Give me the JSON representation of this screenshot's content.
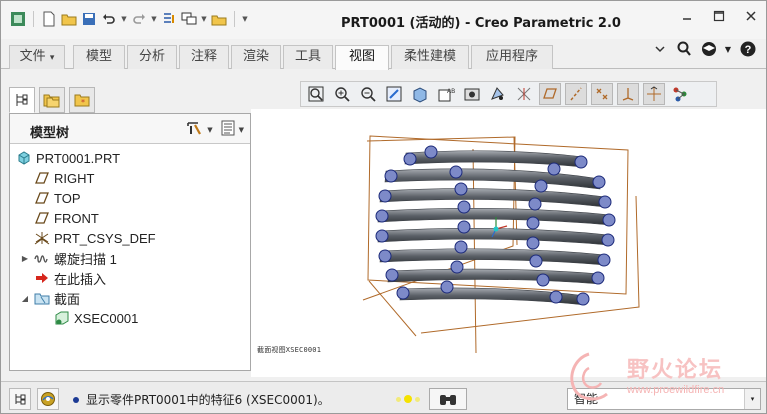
{
  "window": {
    "title": "PRT0001 (活动的) - Creo Parametric 2.0"
  },
  "ribbon": {
    "tabs": [
      {
        "label": "文件",
        "id": "file"
      },
      {
        "label": "模型",
        "id": "model"
      },
      {
        "label": "分析",
        "id": "analysis"
      },
      {
        "label": "注释",
        "id": "annotate"
      },
      {
        "label": "渲染",
        "id": "render"
      },
      {
        "label": "工具",
        "id": "tools"
      },
      {
        "label": "视图",
        "id": "view"
      },
      {
        "label": "柔性建模",
        "id": "flexible"
      },
      {
        "label": "应用程序",
        "id": "apps"
      }
    ],
    "active_tab": "视图",
    "file_dropdown_glyph": "▾"
  },
  "model_tree": {
    "header": "模型树",
    "nodes": [
      {
        "label": "PRT0001.PRT",
        "icon": "part-icon"
      },
      {
        "label": "RIGHT",
        "icon": "datum-plane-icon"
      },
      {
        "label": "TOP",
        "icon": "datum-plane-icon"
      },
      {
        "label": "FRONT",
        "icon": "datum-plane-icon"
      },
      {
        "label": "PRT_CSYS_DEF",
        "icon": "csys-icon"
      },
      {
        "label": "螺旋扫描 1",
        "icon": "helical-sweep-icon",
        "expander": "▶"
      },
      {
        "label": "在此插入",
        "icon": "insert-here-arrow-icon"
      },
      {
        "label": "截面",
        "icon": "sections-folder-icon",
        "expander": "◢"
      },
      {
        "label": "XSEC0001",
        "icon": "xsection-icon"
      }
    ]
  },
  "graphics": {
    "section_label": "截面视图XSEC0001"
  },
  "statusbar": {
    "message": "显示零件PRT0001中的特征6 (XSEC0001)。",
    "filter": "智能",
    "filter_arrow": "▾"
  },
  "watermark": {
    "title": "野火论坛",
    "url": "www.proewildfire.cn"
  },
  "colors": {
    "accent": "#1c3a94",
    "datum_plane": "#b06a2a",
    "coil": "#5a5f66",
    "section_circle": "#7d8ac8"
  }
}
